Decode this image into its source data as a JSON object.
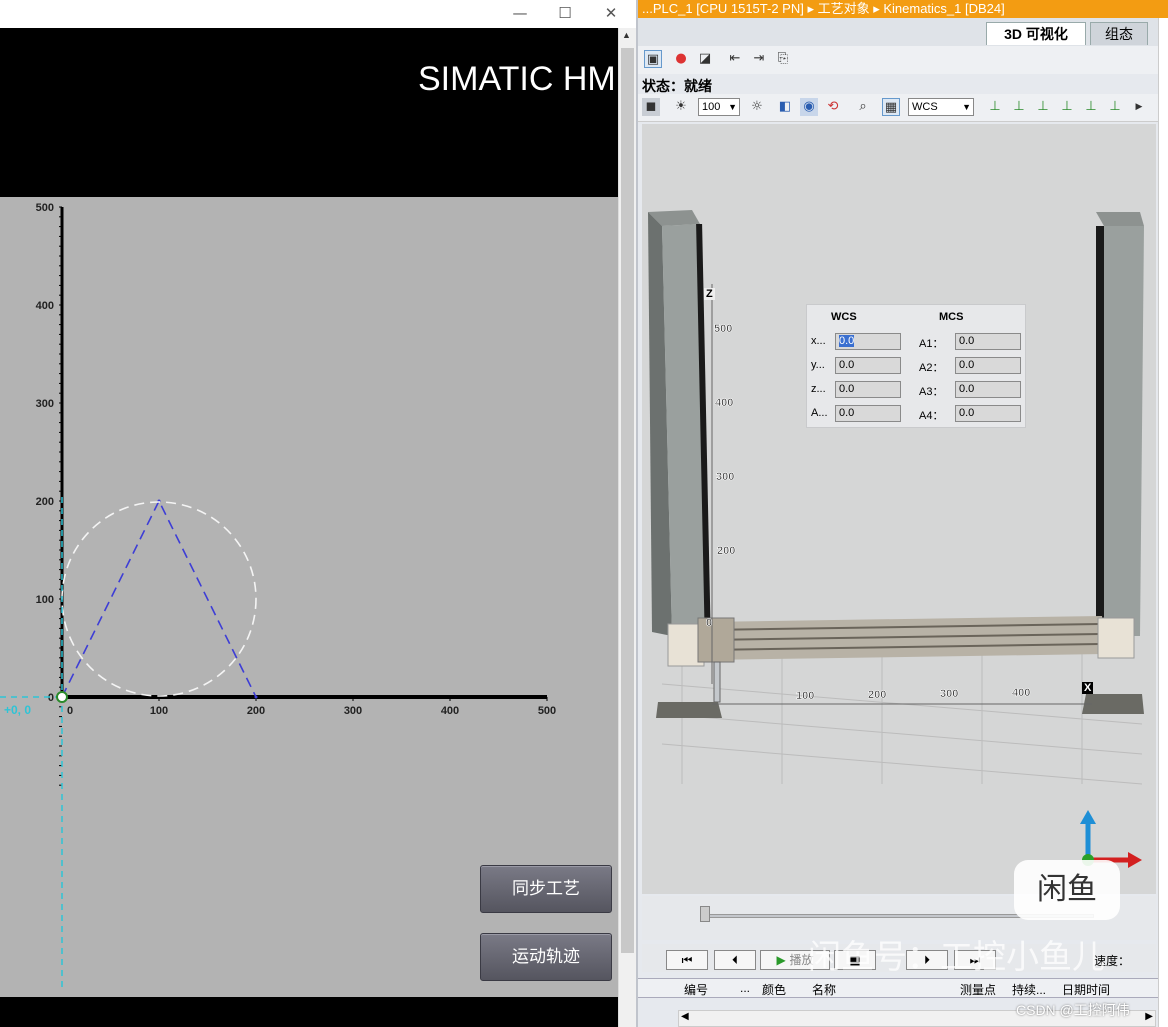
{
  "hmi": {
    "title": "SIMATIC HM",
    "window_controls": {
      "minimize": "—",
      "maximize": "☐",
      "close": "✕"
    },
    "buttons": {
      "sync": "同步工艺",
      "trajectory": "运动轨迹"
    },
    "marker_label": "+0, 0",
    "chart_data": {
      "type": "scatter",
      "x_ticks": [
        "0",
        "100",
        "200",
        "300",
        "400",
        "500"
      ],
      "y_ticks": [
        "0",
        "100",
        "200",
        "300",
        "400",
        "500"
      ],
      "xlim": [
        0,
        500
      ],
      "ylim": [
        0,
        500
      ],
      "grid": false,
      "series": [
        {
          "style": "dashed-blue",
          "points": [
            [
              0,
              0
            ],
            [
              100,
              200
            ],
            [
              200,
              0
            ]
          ]
        },
        {
          "style": "dashed-white-circle",
          "center": [
            100,
            100
          ],
          "radius": 100
        }
      ]
    }
  },
  "tia": {
    "title": "...PLC_1 [CPU 1515T-2 PN] ▸ 工艺对象 ▸ Kinematics_1 [DB24]",
    "tabs": {
      "active": "3D 可视化",
      "other": "组态"
    },
    "status": "状态：就绪",
    "zoom_value": "100",
    "coord_system": "WCS",
    "panel": {
      "wcs_header": "WCS",
      "mcs_header": "MCS",
      "rows": [
        {
          "wcs_label": "x...",
          "wcs_value": "0.0",
          "mcs_label": "A1：",
          "mcs_value": "0.0"
        },
        {
          "wcs_label": "y...",
          "wcs_value": "0.0",
          "mcs_label": "A2：",
          "mcs_value": "0.0"
        },
        {
          "wcs_label": "z...",
          "wcs_value": "0.0",
          "mcs_label": "A3：",
          "mcs_value": "0.0"
        },
        {
          "wcs_label": "A...",
          "wcs_value": "0.0",
          "mcs_label": "A4：",
          "mcs_value": "0.0"
        }
      ]
    },
    "axes_labels": {
      "z": "Z",
      "x": "X",
      "z_ticks": [
        "500",
        "400",
        "300",
        "200",
        "0"
      ],
      "x_ticks": [
        "100",
        "200",
        "300",
        "400"
      ]
    },
    "playback": {
      "play": "播放",
      "speed_label": "速度："
    },
    "table_headers": [
      "编号",
      "...",
      "颜色",
      "名称",
      "测量点",
      "持续...",
      "日期时间"
    ]
  },
  "overlay": {
    "watermark": "闲鱼号：工控小鱼儿",
    "logo": "闲鱼",
    "csdn": "CSDN @工控阿伟"
  },
  "colors": {
    "accent": "#f39c12",
    "hmi_bg": "#b3b3b3",
    "trajectory": "#3d3dd6",
    "cursor": "#2ec4d6"
  }
}
